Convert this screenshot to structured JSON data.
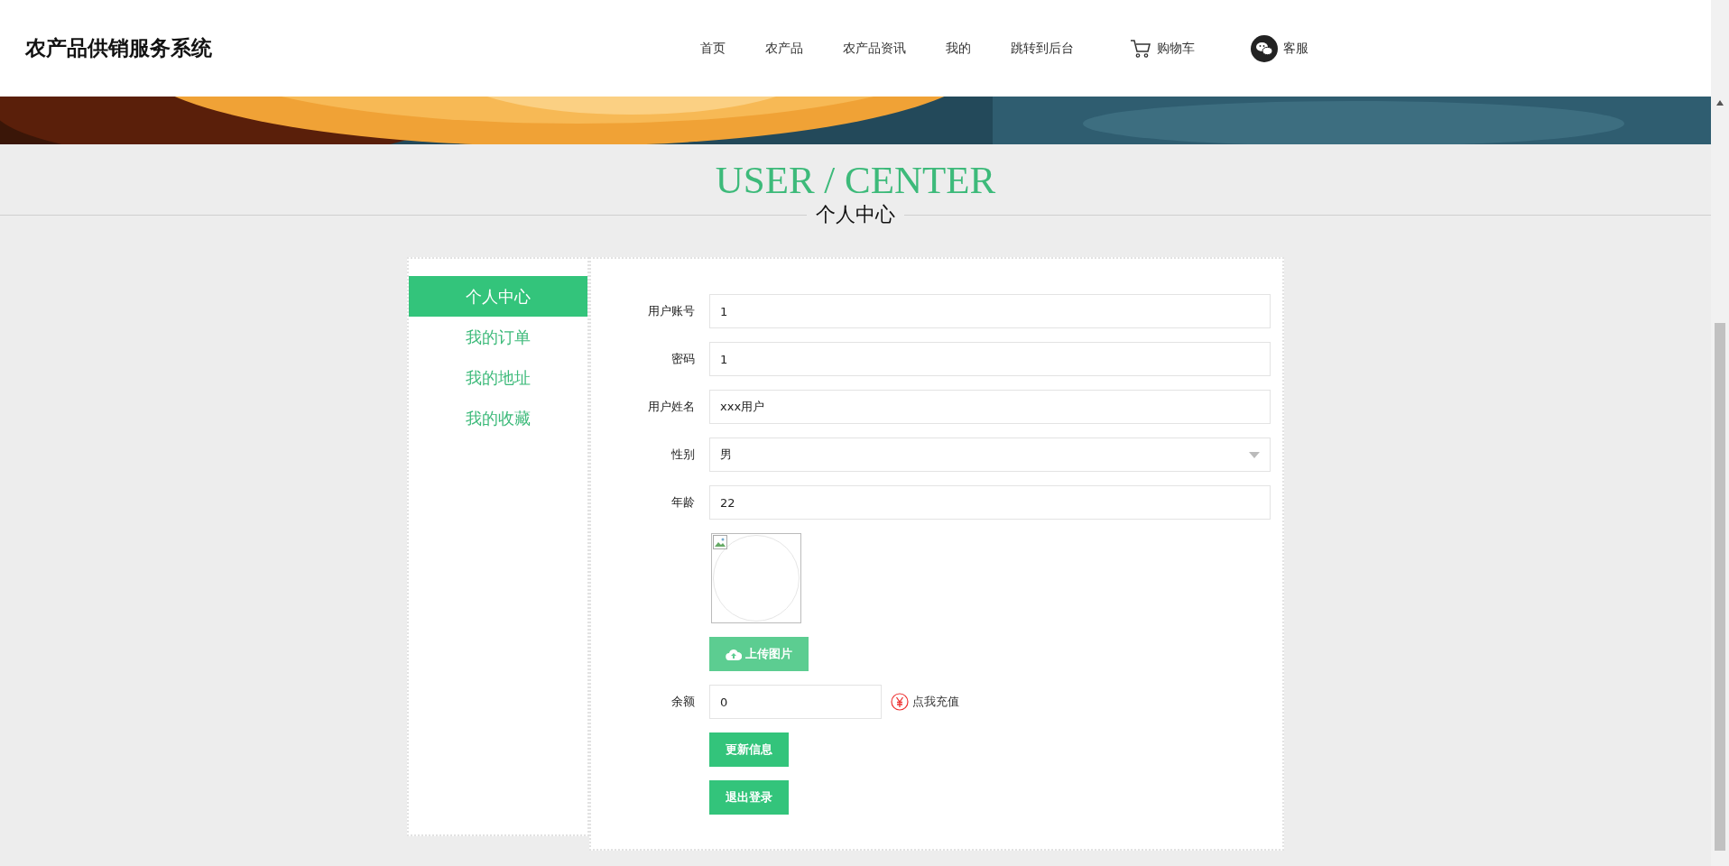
{
  "header": {
    "title": "农产品供销服务系统",
    "nav": [
      {
        "label": "首页",
        "kind": "text"
      },
      {
        "label": "农产品",
        "kind": "text"
      },
      {
        "label": "农产品资讯",
        "kind": "text"
      },
      {
        "label": "我的",
        "kind": "text"
      },
      {
        "label": "跳转到后台",
        "kind": "text"
      },
      {
        "label": "购物车",
        "kind": "cart"
      },
      {
        "label": "客服",
        "kind": "chat"
      }
    ]
  },
  "section": {
    "title": "USER / CENTER",
    "subtitle": "个人中心"
  },
  "sidebar": {
    "items": [
      {
        "label": "个人中心",
        "selected": true
      },
      {
        "label": "我的订单",
        "selected": false
      },
      {
        "label": "我的地址",
        "selected": false
      },
      {
        "label": "我的收藏",
        "selected": false
      }
    ]
  },
  "form": {
    "fields": [
      {
        "label": "用户账号",
        "value": "1",
        "kind": "text"
      },
      {
        "label": "密码",
        "value": "1",
        "kind": "text"
      },
      {
        "label": "用户姓名",
        "value": "xxx用户",
        "kind": "text"
      },
      {
        "label": "性别",
        "value": "男",
        "kind": "select"
      },
      {
        "label": "年龄",
        "value": "22",
        "kind": "text"
      }
    ],
    "upload_button": "上传图片",
    "balance": {
      "label": "余额",
      "value": "0"
    },
    "recharge_link": "点我充值",
    "buttons": [
      "更新信息",
      "退出登录"
    ]
  }
}
